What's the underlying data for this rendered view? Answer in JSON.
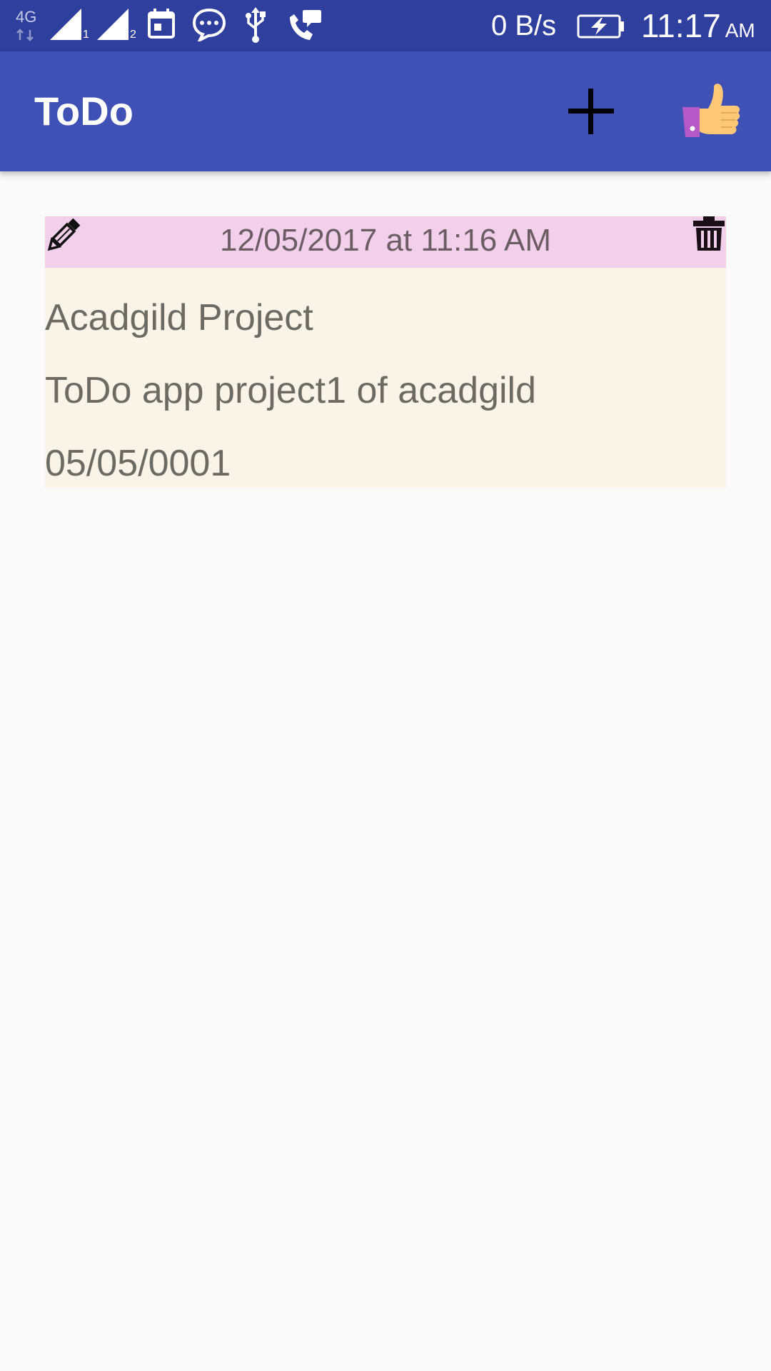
{
  "status_bar": {
    "network_label": "4G",
    "sim1_label": "1",
    "sim2_label": "2",
    "speed": "0 B/s",
    "time": "11:17",
    "ampm": "AM",
    "icons": [
      "network-4g-icon",
      "signal-sim1-icon",
      "signal-sim2-icon",
      "calendar-icon",
      "message-icon",
      "usb-icon",
      "call-message-icon",
      "battery-charging-icon"
    ]
  },
  "app_bar": {
    "title": "ToDo",
    "add_icon": "plus-icon",
    "like_icon": "thumbs-up-icon",
    "color": "#3f51b5"
  },
  "todo_list": {
    "items": [
      {
        "date": "12/05/2017 at 11:16 AM",
        "title": "Acadgild Project",
        "description": "ToDo app project1 of acadgild",
        "due_date": "05/05/0001",
        "header_color": "#f2d0ec",
        "body_color": "#faf4e8"
      }
    ]
  }
}
